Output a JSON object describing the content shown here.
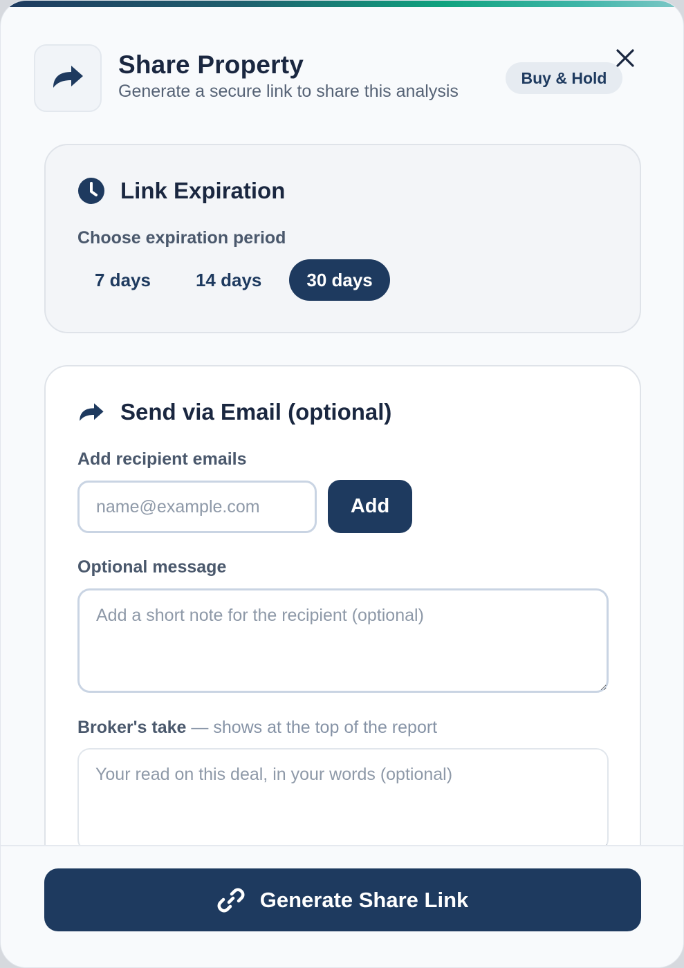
{
  "header": {
    "title": "Share Property",
    "subtitle": "Generate a secure link to share this analysis",
    "badge": "Buy & Hold",
    "icon": "share-icon",
    "close_icon": "close-icon"
  },
  "expiration": {
    "heading": "Link Expiration",
    "icon": "clock-icon",
    "label": "Choose expiration period",
    "options": [
      {
        "label": "7 days",
        "selected": false
      },
      {
        "label": "14 days",
        "selected": false
      },
      {
        "label": "30 days",
        "selected": true
      }
    ]
  },
  "email": {
    "heading": "Send via Email (optional)",
    "icon": "share-icon",
    "recipients_label": "Add recipient emails",
    "email_placeholder": "name@example.com",
    "email_value": "",
    "add_label": "Add",
    "message_label": "Optional message",
    "message_placeholder": "Add a short note for the recipient (optional)",
    "message_value": "",
    "broker_label": "Broker's take",
    "broker_hint": " — shows at the top of the report",
    "broker_placeholder": "Your read on this deal, in your words (optional)",
    "broker_value": ""
  },
  "footer": {
    "generate_label": "Generate Share Link",
    "icon": "link-icon"
  },
  "colors": {
    "primary": "#1e3a5f",
    "text": "#1a2740",
    "muted": "#556275",
    "accent_gradient": [
      "#1e3a5f",
      "#10a37f",
      "#7fc8c8"
    ]
  }
}
